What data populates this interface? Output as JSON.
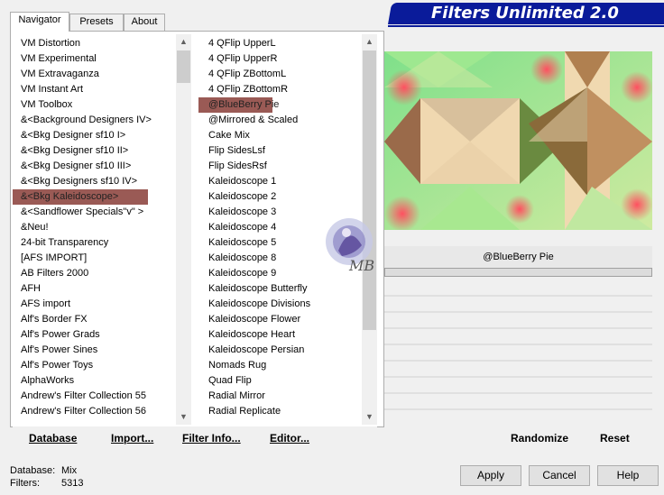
{
  "app": {
    "title": "Filters Unlimited 2.0"
  },
  "tabs": [
    {
      "label": "Navigator",
      "active": true
    },
    {
      "label": "Presets",
      "active": false
    },
    {
      "label": "About",
      "active": false
    }
  ],
  "categories": {
    "items": [
      "VM Distortion",
      "VM Experimental",
      "VM Extravaganza",
      "VM Instant Art",
      "VM Toolbox",
      "&<Background Designers IV>",
      "&<Bkg Designer sf10 I>",
      "&<Bkg Designer sf10 II>",
      "&<Bkg Designer sf10 III>",
      "&<Bkg Designers sf10 IV>",
      "&<Bkg Kaleidoscope>",
      "&<Sandflower Specials\"v\" >",
      "&Neu!",
      "24-bit Transparency",
      "[AFS IMPORT]",
      "AB Filters 2000",
      "AFH",
      "AFS import",
      "Alf's Border FX",
      "Alf's Power Grads",
      "Alf's Power Sines",
      "Alf's Power Toys",
      "AlphaWorks",
      "Andrew's Filter Collection 55",
      "Andrew's Filter Collection 56"
    ],
    "selected_index": 10
  },
  "filters": {
    "items": [
      "4 QFlip UpperL",
      "4 QFlip UpperR",
      "4 QFlip ZBottomL",
      "4 QFlip ZBottomR",
      "@BlueBerry Pie",
      "@Mirrored & Scaled",
      "Cake Mix",
      "Flip SidesLsf",
      "Flip SidesRsf",
      "Kaleidoscope 1",
      "Kaleidoscope 2",
      "Kaleidoscope 3",
      "Kaleidoscope 4",
      "Kaleidoscope 5",
      "Kaleidoscope 8",
      "Kaleidoscope 9",
      "Kaleidoscope Butterfly",
      "Kaleidoscope Divisions",
      "Kaleidoscope Flower",
      "Kaleidoscope Heart",
      "Kaleidoscope Persian",
      "Nomads Rug",
      "Quad Flip",
      "Radial Mirror",
      "Radial Replicate"
    ],
    "selected_index": 4
  },
  "left_toolbar": {
    "database": "Database",
    "import": "Import...",
    "filter_info": "Filter Info...",
    "editor": "Editor..."
  },
  "preview": {
    "filter_name": "@BlueBerry Pie"
  },
  "right_toolbar": {
    "randomize": "Randomize",
    "reset": "Reset"
  },
  "status": {
    "database_label": "Database:",
    "database_value": "Mix",
    "filters_label": "Filters:",
    "filters_value": "5313"
  },
  "dialog_buttons": {
    "apply": "Apply",
    "cancel": "Cancel",
    "help": "Help"
  },
  "colors": {
    "banner": "#0a1b9a",
    "selection": "#9a5a55"
  },
  "icons": {
    "scroll_up": "arrow-up-icon",
    "scroll_down": "arrow-down-icon",
    "watermark": "watermark-logo"
  }
}
